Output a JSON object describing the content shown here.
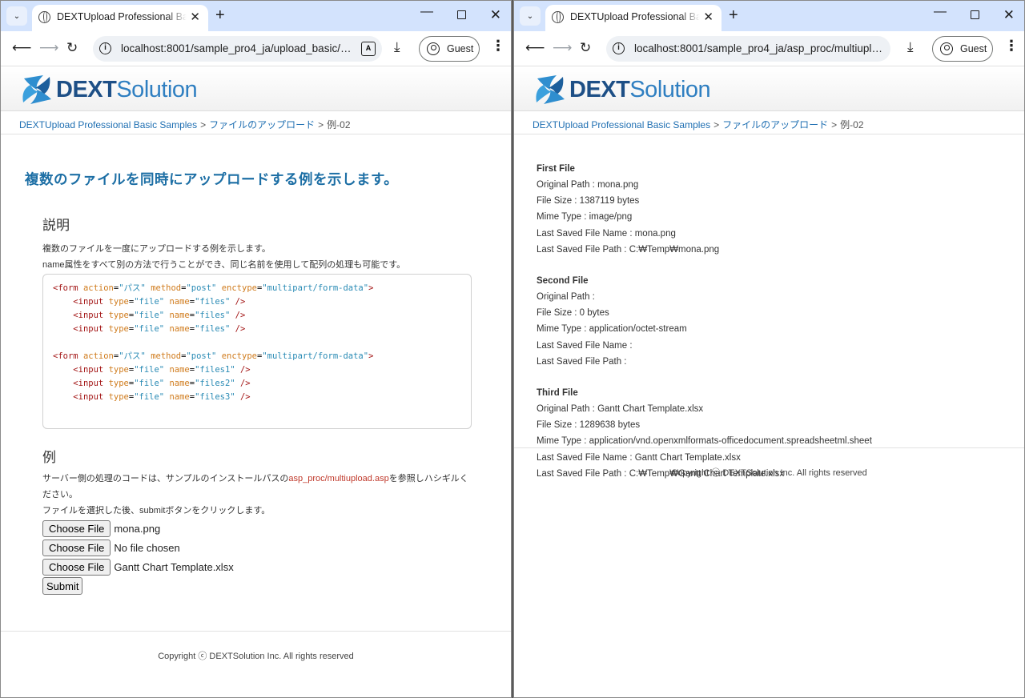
{
  "left": {
    "tab_title": "DEXTUpload Professional Basic",
    "url": "localhost:8001/sample_pro4_ja/upload_basic/ex...",
    "guest_label": "Guest",
    "logo": {
      "part1": "DEXT",
      "part2": "Solution"
    },
    "breadcrumb": {
      "home": "DEXTUpload Professional Basic Samples",
      "sep1": ">",
      "section": "ファイルのアップロード",
      "sep2": ">",
      "current": "例-02"
    },
    "main_title": "複数のファイルを同時にアップロードする例を示します。",
    "explain_heading": "説明",
    "explain_line1": "複数のファイルを一度にアップロードする例を示します。",
    "explain_line2": "name属性をすべて別の方法で行うことができ、同じ名前を使用して配列の処理も可能です。",
    "code": {
      "form_open": "<form",
      "attr_action": "action",
      "val_action": "\"パス\"",
      "attr_method": "method",
      "val_method": "\"post\"",
      "attr_enctype": "enctype",
      "val_enctype": "\"multipart/form-data\"",
      "close_bracket": ">",
      "input_open": "<input",
      "attr_type": "type",
      "val_type": "\"file\"",
      "attr_name": "name",
      "val_files": "\"files\"",
      "val_files1": "\"files1\"",
      "val_files2": "\"files2\"",
      "val_files3": "\"files3\"",
      "self_close": "/>",
      "eq": "="
    },
    "example_heading": "例",
    "example_desc_pre": "サーバー側の処理のコードは、サンプルのインストールパスの",
    "example_desc_path": "asp_proc/multiupload.asp",
    "example_desc_post": "を参照しハシギルください。",
    "example_desc2": "ファイルを選択した後、submitボタンをクリックします。",
    "file_inputs": [
      {
        "button": "Choose File",
        "value": "mona.png"
      },
      {
        "button": "Choose File",
        "value": "No file chosen"
      },
      {
        "button": "Choose File",
        "value": "Gantt Chart Template.xlsx"
      }
    ],
    "submit_label": "Submit",
    "footer": "Copyright ⓒ DEXTSolution Inc. All rights reserved"
  },
  "right": {
    "tab_title": "DEXTUpload Professional Basic",
    "url": "localhost:8001/sample_pro4_ja/asp_proc/multiuplo...",
    "guest_label": "Guest",
    "logo": {
      "part1": "DEXT",
      "part2": "Solution"
    },
    "breadcrumb": {
      "home": "DEXTUpload Professional Basic Samples",
      "sep1": ">",
      "section": "ファイルのアップロード",
      "sep2": ">",
      "current": "例-02"
    },
    "files": [
      {
        "title": "First File",
        "lines": [
          "Original Path : mona.png",
          "File Size : 1387119 bytes",
          "Mime Type : image/png",
          "Last Saved File Name : mona.png",
          "Last Saved File Path : C:₩Temp₩mona.png"
        ]
      },
      {
        "title": "Second File",
        "lines": [
          "Original Path :",
          "File Size : 0 bytes",
          "Mime Type : application/octet-stream",
          "Last Saved File Name :",
          "Last Saved File Path :"
        ]
      },
      {
        "title": "Third File",
        "lines": [
          "Original Path : Gantt Chart Template.xlsx",
          "File Size : 1289638 bytes",
          "Mime Type : application/vnd.openxmlformats-officedocument.spreadsheetml.sheet",
          "Last Saved File Name : Gantt Chart Template.xlsx",
          "Last Saved File Path : C:₩Temp₩Gantt Chart Template.xlsx"
        ]
      }
    ],
    "footer": "Copyright ⓒ DEXTSolution Inc. All rights reserved"
  },
  "colors": {
    "tabstrip": "#d3e3fd",
    "title_blue": "#1d6fa5",
    "link_blue": "#1f6fb2",
    "logo_dark": "#1d4f86",
    "logo_light": "#2f7fc1",
    "path_red": "#c0392b"
  },
  "icons": [
    "chevron-down-icon",
    "globe-icon",
    "close-icon",
    "plus-icon",
    "minimize-icon",
    "maximize-icon",
    "back-arrow-icon",
    "forward-arrow-icon",
    "reload-icon",
    "info-icon",
    "translate-icon",
    "download-icon",
    "account-icon",
    "kebab-menu-icon",
    "dext-logo-icon"
  ]
}
